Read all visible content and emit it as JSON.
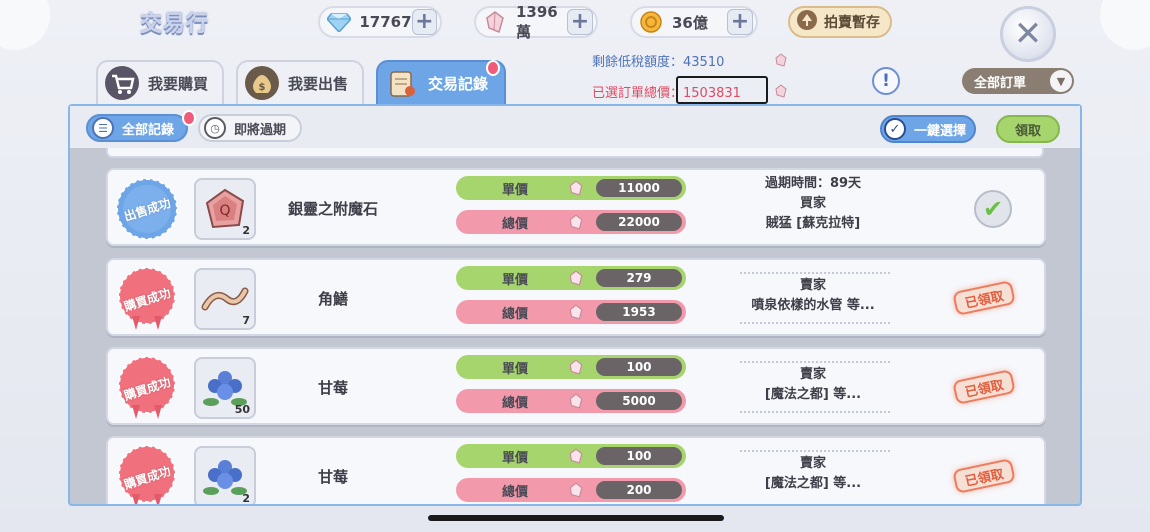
{
  "header": {
    "title": "交易行",
    "diamonds": "17767",
    "crystals": "1396萬",
    "zeny": "36億",
    "auction_storage": "拍賣暫存"
  },
  "tabs": [
    {
      "label": "我要購買"
    },
    {
      "label": "我要出售"
    },
    {
      "label": "交易記錄"
    }
  ],
  "summary": {
    "tax_label": "剩餘低稅額度：",
    "tax_value": "43510",
    "selected_label": "已選訂單總價：",
    "selected_value": "1503831"
  },
  "help_label": "!",
  "filter": {
    "selected": "全部訂單"
  },
  "subtabs": [
    {
      "label": "全部記錄"
    },
    {
      "label": "即將過期"
    }
  ],
  "actions": {
    "one_click": "一鍵選擇",
    "claim": "領取"
  },
  "labels": {
    "unit_price": "單價",
    "total_price": "總價"
  },
  "records": [
    {
      "status": "出售成功",
      "item": "銀靈之附魔石",
      "qty": "2",
      "unit_price": "11000",
      "total_price": "22000",
      "line1": "過期時間：89天",
      "line2": "買家",
      "line3": "賊猛 [蘇克拉特]",
      "result": "checked"
    },
    {
      "status": "購買成功",
      "item": "角鱔",
      "qty": "7",
      "unit_price": "279",
      "total_price": "1953",
      "line2": "賣家",
      "line3": "噴泉依樣的水管 等...",
      "result": "已領取"
    },
    {
      "status": "購買成功",
      "item": "甘莓",
      "qty": "50",
      "unit_price": "100",
      "total_price": "5000",
      "line2": "賣家",
      "line3": "[魔法之都] 等...",
      "result": "已領取"
    },
    {
      "status": "購買成功",
      "item": "甘莓",
      "qty": "2",
      "unit_price": "100",
      "total_price": "200",
      "line2": "賣家",
      "line3": "[魔法之都] 等...",
      "result": "已領取"
    }
  ],
  "colors": {
    "accent_blue": "#6ea5e6",
    "sold_badge": "#6ea5e6",
    "bought_badge": "#f0707e",
    "unit_pill": "#a6d46d",
    "total_pill": "#f29aab",
    "claimed": "#e25e3d"
  }
}
